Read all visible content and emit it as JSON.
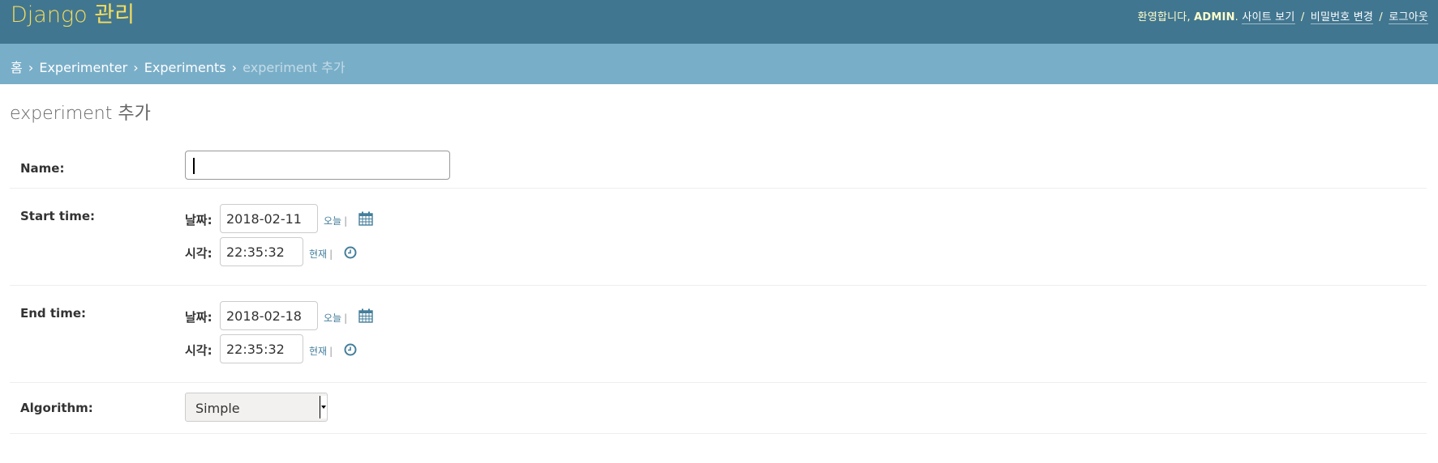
{
  "header": {
    "branding": "Django 관리",
    "welcome": "환영합니다,",
    "username": "ADMIN",
    "username_suffix": ".",
    "links": {
      "view_site": "사이트 보기",
      "change_password": "비밀번호 변경",
      "logout": "로그아웃"
    },
    "separator": "/"
  },
  "breadcrumbs": {
    "home": "홈",
    "app": "Experimenter",
    "model": "Experiments",
    "current": "experiment 추가",
    "arrow": "›"
  },
  "page": {
    "title": "experiment 추가"
  },
  "form": {
    "name": {
      "label": "Name:",
      "value": ""
    },
    "start_time": {
      "label": "Start time:",
      "date_label": "날짜:",
      "date_value": "2018-02-11",
      "date_shortcut": "오늘",
      "time_label": "시각:",
      "time_value": "22:35:32",
      "time_shortcut": "현재"
    },
    "end_time": {
      "label": "End time:",
      "date_label": "날짜:",
      "date_value": "2018-02-18",
      "date_shortcut": "오늘",
      "time_label": "시각:",
      "time_value": "22:35:32",
      "time_shortcut": "현재"
    },
    "algorithm": {
      "label": "Algorithm:",
      "selected": "Simple"
    },
    "shortcut_separator": "|"
  },
  "colors": {
    "header_bg": "#417690",
    "breadcrumbs_bg": "#79aec8",
    "branding": "#f5dd5d",
    "link": "#447e9b"
  }
}
